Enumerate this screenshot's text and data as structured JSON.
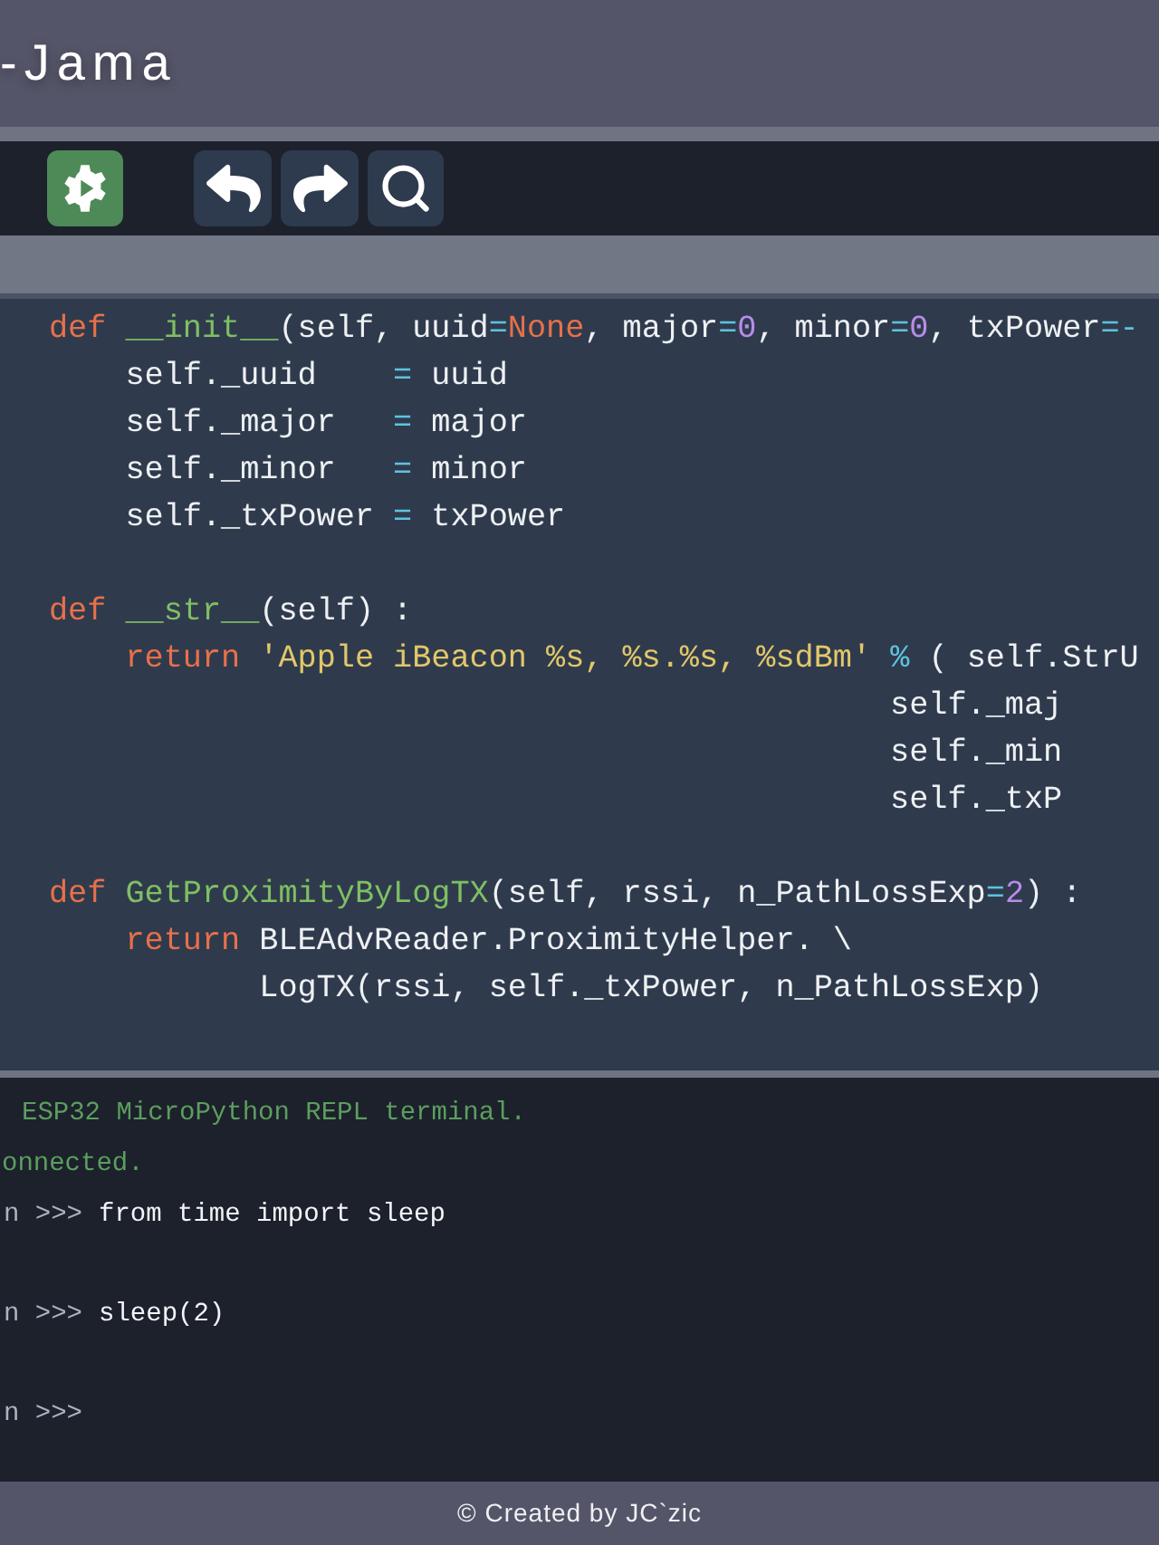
{
  "header": {
    "title": "-Jama"
  },
  "toolbar": [
    {
      "kind": "run-settings"
    },
    {
      "kind": "undo"
    },
    {
      "kind": "redo"
    },
    {
      "kind": "search"
    }
  ],
  "code": [
    {
      "segments": [
        {
          "color": "#e8704a",
          "text": "def"
        },
        {
          "color": "#7fbf63",
          "text": " __init__"
        },
        {
          "color": "#eef0f3",
          "text": "(self, uuid"
        },
        {
          "color": "#5fc3e0",
          "text": "="
        },
        {
          "color": "#e8704a",
          "text": "None"
        },
        {
          "color": "#eef0f3",
          "text": ", major"
        },
        {
          "color": "#5fc3e0",
          "text": "="
        },
        {
          "color": "#b98ce8",
          "text": "0"
        },
        {
          "color": "#eef0f3",
          "text": ", minor"
        },
        {
          "color": "#5fc3e0",
          "text": "="
        },
        {
          "color": "#b98ce8",
          "text": "0"
        },
        {
          "color": "#eef0f3",
          "text": ", txPower"
        },
        {
          "color": "#5fc3e0",
          "text": "=-"
        }
      ]
    },
    {
      "segments": [
        {
          "color": "#eef0f3",
          "text": "    self._uuid    "
        },
        {
          "color": "#5fc3e0",
          "text": "="
        },
        {
          "color": "#eef0f3",
          "text": " uuid"
        }
      ]
    },
    {
      "segments": [
        {
          "color": "#eef0f3",
          "text": "    self._major   "
        },
        {
          "color": "#5fc3e0",
          "text": "="
        },
        {
          "color": "#eef0f3",
          "text": " major"
        }
      ]
    },
    {
      "segments": [
        {
          "color": "#eef0f3",
          "text": "    self._minor   "
        },
        {
          "color": "#5fc3e0",
          "text": "="
        },
        {
          "color": "#eef0f3",
          "text": " minor"
        }
      ]
    },
    {
      "segments": [
        {
          "color": "#eef0f3",
          "text": "    self._txPower "
        },
        {
          "color": "#5fc3e0",
          "text": "="
        },
        {
          "color": "#eef0f3",
          "text": " txPower"
        }
      ]
    },
    {
      "blank_before": true,
      "segments": [
        {
          "color": "#e8704a",
          "text": "def"
        },
        {
          "color": "#7fbf63",
          "text": " __str__"
        },
        {
          "color": "#eef0f3",
          "text": "(self) :"
        }
      ]
    },
    {
      "segments": [
        {
          "color": "#e8704a",
          "text": "    return"
        },
        {
          "color": "#e2c76a",
          "text": " 'Apple iBeacon %s, %s.%s, %sdBm'"
        },
        {
          "color": "#5fc3e0",
          "text": " %"
        },
        {
          "color": "#eef0f3",
          "text": " ( self.StrU"
        }
      ]
    },
    {
      "segments": [
        {
          "color": "#eef0f3",
          "text": "                                            self._maj"
        }
      ]
    },
    {
      "segments": [
        {
          "color": "#eef0f3",
          "text": "                                            self._min"
        }
      ]
    },
    {
      "segments": [
        {
          "color": "#eef0f3",
          "text": "                                            self._txP"
        }
      ]
    },
    {
      "blank_before": true,
      "segments": [
        {
          "color": "#e8704a",
          "text": "def"
        },
        {
          "color": "#7fbf63",
          "text": " GetProximityByLogTX"
        },
        {
          "color": "#eef0f3",
          "text": "(self, rssi, n_PathLossExp"
        },
        {
          "color": "#5fc3e0",
          "text": "="
        },
        {
          "color": "#b98ce8",
          "text": "2"
        },
        {
          "color": "#eef0f3",
          "text": ") :"
        }
      ]
    },
    {
      "segments": [
        {
          "color": "#e8704a",
          "text": "    return"
        },
        {
          "color": "#eef0f3",
          "text": " BLEAdvReader.ProximityHelper. \\"
        }
      ]
    },
    {
      "segments": [
        {
          "color": "#eef0f3",
          "text": "           LogTX(rssi, self._txPower, n_PathLossExp)"
        }
      ]
    }
  ],
  "terminal": [
    {
      "message": "ESP32 MicroPython REPL terminal."
    },
    {
      "message": "onnected."
    },
    {
      "prompt": "n >>>",
      "command": "from time import sleep"
    },
    {
      "blank_before": true,
      "prompt": "n >>>",
      "command": "sleep(2)"
    },
    {
      "blank_before": true,
      "prompt": "n >>>"
    }
  ],
  "footer": {
    "text": "© Created by JC`zic"
  }
}
